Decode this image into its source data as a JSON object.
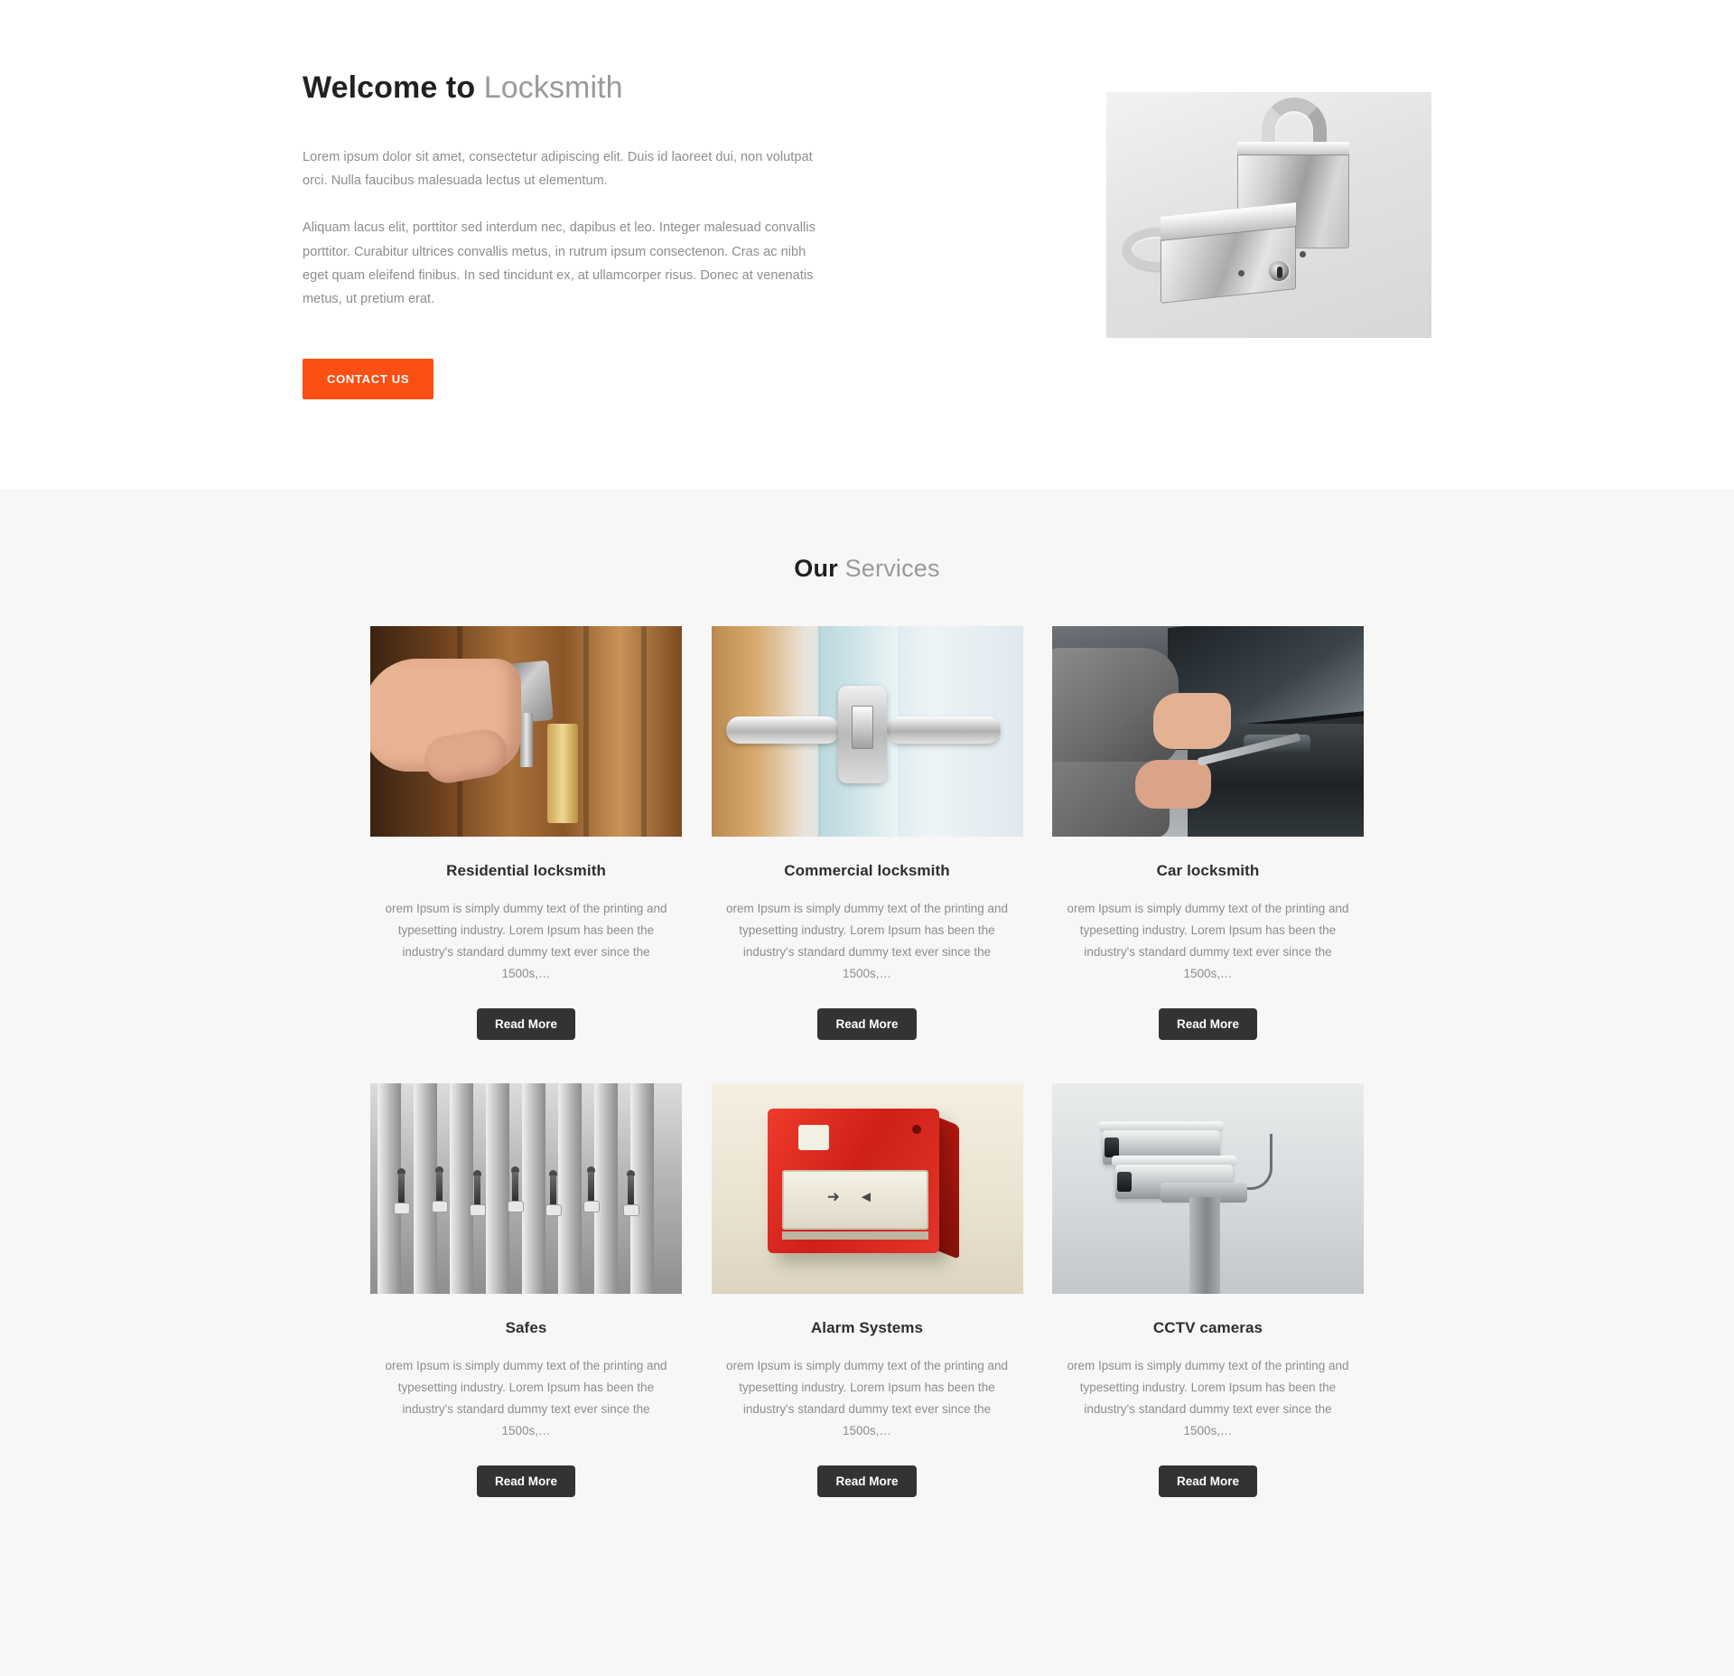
{
  "hero": {
    "title_strong": "Welcome to",
    "title_light": "Locksmith",
    "paragraph_1": "Lorem ipsum dolor sit amet, consectetur adipiscing elit. Duis id laoreet dui, non volutpat orci. Nulla faucibus malesuada lectus ut elementum.",
    "paragraph_2": "Aliquam lacus elit, porttitor sed interdum nec, dapibus et leo. Integer malesuad convallis porttitor. Curabitur ultrices convallis metus, in rutrum ipsum consectenon. Cras ac nibh eget quam eleifend finibus. In sed tincidunt ex, at ullamcorper risus. Donec at venenatis metus, ut pretium erat.",
    "contact_button": "CONTACT US",
    "image_alt": "two-silver-padlocks-photo"
  },
  "services": {
    "title_strong": "Our",
    "title_light": "Services",
    "read_more_label": "Read More",
    "body_text": "orem Ipsum is simply dummy text of the printing and typesetting industry. Lorem Ipsum has been the industry's standard dummy text ever since the 1500s,…",
    "cards": [
      {
        "title": "Residential locksmith",
        "image_alt": "hand-with-key-in-wooden-door-photo",
        "text": "orem Ipsum is simply dummy text of the printing and typesetting industry. Lorem Ipsum has been the industry's standard dummy text ever since the 1500s,…",
        "button": "Read More"
      },
      {
        "title": "Commercial locksmith",
        "image_alt": "glass-door-steel-handle-photo",
        "text": "orem Ipsum is simply dummy text of the printing and typesetting industry. Lorem Ipsum has been the industry's standard dummy text ever since the 1500s,…",
        "button": "Read More"
      },
      {
        "title": "Car locksmith",
        "image_alt": "person-opening-car-door-with-tool-photo",
        "text": "orem Ipsum is simply dummy text of the printing and typesetting industry. Lorem Ipsum has been the industry's standard dummy text ever since the 1500s,…",
        "button": "Read More"
      },
      {
        "title": "Safes",
        "image_alt": "keys-hanging-on-rack-photo",
        "text": "orem Ipsum is simply dummy text of the printing and typesetting industry. Lorem Ipsum has been the industry's standard dummy text ever since the 1500s,…",
        "button": "Read More"
      },
      {
        "title": "Alarm Systems",
        "image_alt": "red-fire-alarm-call-point-photo",
        "text": "orem Ipsum is simply dummy text of the printing and typesetting industry. Lorem Ipsum has been the industry's standard dummy text ever since the 1500s,…",
        "button": "Read More"
      },
      {
        "title": "CCTV cameras",
        "image_alt": "two-cctv-cameras-on-pole-photo",
        "text": "orem Ipsum is simply dummy text of the printing and typesetting industry. Lorem Ipsum has been the industry's standard dummy text ever since the 1500s,…",
        "button": "Read More"
      }
    ]
  },
  "colors": {
    "accent_orange": "#fb4f14",
    "button_dark": "#333333",
    "section_bg": "#f7f7f7",
    "page_bg": "#ffffff",
    "heading_dark": "#212121",
    "heading_light": "#9a9a9a",
    "body_text": "#8d8d8d"
  },
  "alarm_arrows": "➜ ◄"
}
